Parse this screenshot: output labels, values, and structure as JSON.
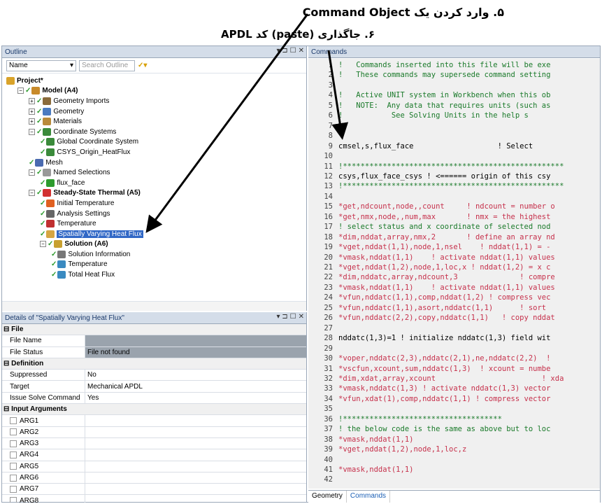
{
  "annotations": {
    "step5": "۵. وارد کردن یک Command Object",
    "step6": "۶. جاگذاری (paste) کد APDL"
  },
  "outline": {
    "title": "Outline",
    "name_combo": "Name",
    "search_placeholder": "Search Outline",
    "tree": [
      {
        "label": "Project*",
        "bold": true,
        "indent": 0,
        "icon": "project-icon"
      },
      {
        "label": "Model (A4)",
        "bold": true,
        "indent": 1,
        "icon": "model-icon"
      },
      {
        "label": "Geometry Imports",
        "indent": 2,
        "icon": "geometry-imports-icon"
      },
      {
        "label": "Geometry",
        "indent": 2,
        "icon": "geometry-icon"
      },
      {
        "label": "Materials",
        "indent": 2,
        "icon": "materials-icon"
      },
      {
        "label": "Coordinate Systems",
        "indent": 2,
        "icon": "coordinate-systems-icon"
      },
      {
        "label": "Global Coordinate System",
        "indent": 3,
        "icon": "coordinate-system-icon"
      },
      {
        "label": "CSYS_Origin_HeatFlux",
        "indent": 3,
        "icon": "coordinate-system-icon"
      },
      {
        "label": "Mesh",
        "indent": 2,
        "icon": "mesh-icon"
      },
      {
        "label": "Named Selections",
        "indent": 2,
        "icon": "named-selections-icon"
      },
      {
        "label": "flux_face",
        "indent": 3,
        "icon": "named-selection-icon"
      },
      {
        "label": "Steady-State Thermal (A5)",
        "bold": true,
        "indent": 2,
        "icon": "thermal-analysis-icon"
      },
      {
        "label": "Initial Temperature",
        "indent": 3,
        "icon": "initial-temperature-icon"
      },
      {
        "label": "Analysis Settings",
        "indent": 3,
        "icon": "analysis-settings-icon"
      },
      {
        "label": "Temperature",
        "indent": 3,
        "icon": "temperature-icon"
      },
      {
        "label": "Spatially Varying Heat Flux",
        "indent": 3,
        "icon": "command-object-icon",
        "selected": true
      },
      {
        "label": "Solution (A6)",
        "bold": true,
        "indent": 3,
        "icon": "solution-icon"
      },
      {
        "label": "Solution Information",
        "indent": 4,
        "icon": "solution-information-icon"
      },
      {
        "label": "Temperature",
        "indent": 4,
        "icon": "result-icon"
      },
      {
        "label": "Total Heat Flux",
        "indent": 4,
        "icon": "result-icon"
      }
    ]
  },
  "details": {
    "title": "Details of \"Spatially Varying Heat Flux\"",
    "sections": [
      {
        "name": "File",
        "rows": [
          {
            "k": "File Name",
            "v": ""
          },
          {
            "k": "File Status",
            "v": "File not found"
          }
        ]
      },
      {
        "name": "Definition",
        "rows": [
          {
            "k": "Suppressed",
            "v": "No"
          },
          {
            "k": "Target",
            "v": "Mechanical APDL"
          },
          {
            "k": "Issue Solve Command",
            "v": "Yes"
          }
        ]
      },
      {
        "name": "Input Arguments",
        "rows": [
          {
            "k": "ARG1"
          },
          {
            "k": "ARG2"
          },
          {
            "k": "ARG3"
          },
          {
            "k": "ARG4"
          },
          {
            "k": "ARG5"
          },
          {
            "k": "ARG6"
          },
          {
            "k": "ARG7"
          },
          {
            "k": "ARG8"
          }
        ]
      }
    ]
  },
  "commands": {
    "title": "Commands",
    "lines": [
      {
        "n": "1",
        "t": "!   Commands inserted into this file will be exe",
        "c": "cmt"
      },
      {
        "n": "2",
        "t": "!   These commands may supersede command setting",
        "c": "cmt"
      },
      {
        "n": "3",
        "t": "",
        "c": ""
      },
      {
        "n": "4",
        "t": "!   Active UNIT system in Workbench when this ob",
        "c": "cmt"
      },
      {
        "n": "5",
        "t": "!   NOTE:  Any data that requires units (such as",
        "c": "cmt"
      },
      {
        "n": "6",
        "t": "!           See Solving Units in the help s",
        "c": "cmt"
      },
      {
        "n": "7",
        "t": "",
        "c": ""
      },
      {
        "n": "8",
        "t": "",
        "c": ""
      },
      {
        "n": "9",
        "t": "cmsel,s,flux_face                   ! Select",
        "c": ""
      },
      {
        "n": "10",
        "t": "",
        "c": ""
      },
      {
        "n": "11",
        "t": "!**************************************************",
        "c": "cmt"
      },
      {
        "n": "12",
        "t": "csys,flux_face_csys ! <====== origin of this csy",
        "c": ""
      },
      {
        "n": "13",
        "t": "!**************************************************",
        "c": "cmt"
      },
      {
        "n": "14",
        "t": "",
        "c": ""
      },
      {
        "n": "15",
        "t": "*get,ndcount,node,,count     ! ndcount = number o",
        "c": "kw"
      },
      {
        "n": "16",
        "t": "*get,nmx,node,,num,max       ! nmx = the highest",
        "c": "kw"
      },
      {
        "n": "17",
        "t": "! select status and x coordinate of selected nod",
        "c": "cmt"
      },
      {
        "n": "18",
        "t": "*dim,nddat,array,nmx,2       ! define an array nd",
        "c": "kw"
      },
      {
        "n": "19",
        "t": "*vget,nddat(1,1),node,1,nsel    ! nddat(1,1) = -",
        "c": "kw"
      },
      {
        "n": "20",
        "t": "*vmask,nddat(1,1)    ! activate nddat(1,1) values",
        "c": "kw"
      },
      {
        "n": "21",
        "t": "*vget,nddat(1,2),node,1,loc,x ! nddat(1,2) = x c",
        "c": "kw"
      },
      {
        "n": "22",
        "t": "*dim,nddatc,array,ndcount,3              ! compre",
        "c": "kw"
      },
      {
        "n": "23",
        "t": "*vmask,nddat(1,1)    ! activate nddat(1,1) values",
        "c": "kw"
      },
      {
        "n": "24",
        "t": "*vfun,nddatc(1,1),comp,nddat(1,2) ! compress vec",
        "c": "kw"
      },
      {
        "n": "25",
        "t": "*vfun,nddatc(1,1),asort,nddatc(1,1)      ! sort",
        "c": "kw"
      },
      {
        "n": "26",
        "t": "*vfun,nddatc(2,2),copy,nddatc(1,1)   ! copy nddat",
        "c": "kw"
      },
      {
        "n": "27",
        "t": "",
        "c": ""
      },
      {
        "n": "28",
        "t": "nddatc(1,3)=1 ! initialize nddatc(1,3) field wit",
        "c": ""
      },
      {
        "n": "29",
        "t": "",
        "c": ""
      },
      {
        "n": "30",
        "t": "*voper,nddatc(2,3),nddatc(2,1),ne,nddatc(2,2)  !",
        "c": "kw"
      },
      {
        "n": "31",
        "t": "*vscfun,xcount,sum,nddatc(1,3)  ! xcount = numbe",
        "c": "kw"
      },
      {
        "n": "32",
        "t": "*dim,xdat,array,xcount                        ! xda",
        "c": "kw"
      },
      {
        "n": "33",
        "t": "*vmask,nddatc(1,3) ! activate nddatc(1,3) vector",
        "c": "kw"
      },
      {
        "n": "34",
        "t": "*vfun,xdat(1),comp,nddatc(1,1) ! compress vector",
        "c": "kw"
      },
      {
        "n": "35",
        "t": "",
        "c": ""
      },
      {
        "n": "36",
        "t": "!************************************",
        "c": "cmt"
      },
      {
        "n": "37",
        "t": "! the below code is the same as above but to loc",
        "c": "cmt"
      },
      {
        "n": "38",
        "t": "*vmask,nddat(1,1)",
        "c": "kw"
      },
      {
        "n": "39",
        "t": "*vget,nddat(1,2),node,1,loc,z",
        "c": "kw"
      },
      {
        "n": "40",
        "t": "",
        "c": ""
      },
      {
        "n": "41",
        "t": "*vmask,nddat(1,1)",
        "c": "kw"
      },
      {
        "n": "42",
        "t": "",
        "c": ""
      }
    ],
    "tabs": [
      "Geometry",
      "Commands"
    ]
  }
}
